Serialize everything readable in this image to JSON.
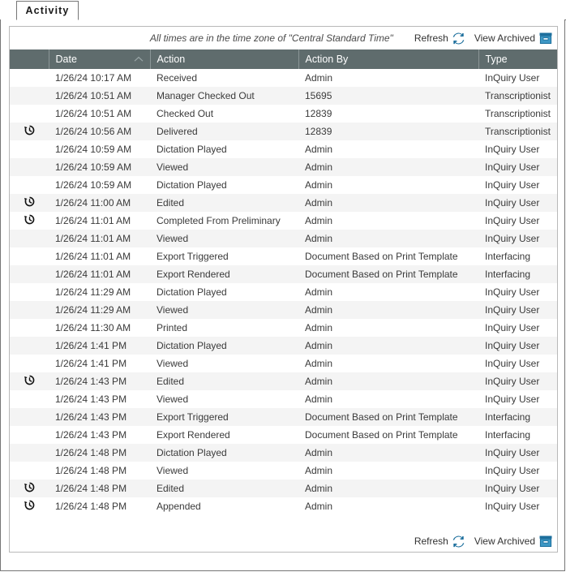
{
  "tab": {
    "label": "Activity"
  },
  "toolbar": {
    "timezone_note": "All times are in the time zone of \"Central Standard Time\"",
    "refresh_label": "Refresh",
    "refresh_icon": "refresh-icon",
    "view_archived_label": "View Archived",
    "view_archived_icon": "archive-box-icon"
  },
  "footer": {
    "refresh_label": "Refresh",
    "refresh_icon": "refresh-icon",
    "view_archived_label": "View Archived",
    "view_archived_icon": "archive-box-icon"
  },
  "colors": {
    "header_bg": "#5f6c6d",
    "accent_icon": "#1b6e9c",
    "row_alt_bg": "#f4f4f4",
    "frame_border": "#767676",
    "card_border": "#b9b9b9"
  },
  "table": {
    "columns": [
      {
        "key": "history",
        "label": ""
      },
      {
        "key": "date",
        "label": "Date",
        "sorted": "asc",
        "sort_icon": "sort-ascending-caret-icon"
      },
      {
        "key": "action",
        "label": "Action"
      },
      {
        "key": "action_by",
        "label": "Action By"
      },
      {
        "key": "type",
        "label": "Type"
      }
    ],
    "rows": [
      {
        "history": false,
        "date": "1/26/24 10:17 AM",
        "action": "Received",
        "action_by": "Admin",
        "type": "InQuiry User"
      },
      {
        "history": false,
        "date": "1/26/24 10:51 AM",
        "action": "Manager Checked Out",
        "action_by": "15695",
        "type": "Transcriptionist"
      },
      {
        "history": false,
        "date": "1/26/24 10:51 AM",
        "action": "Checked Out",
        "action_by": "12839",
        "type": "Transcriptionist"
      },
      {
        "history": true,
        "date": "1/26/24 10:56 AM",
        "action": "Delivered",
        "action_by": "12839",
        "type": "Transcriptionist"
      },
      {
        "history": false,
        "date": "1/26/24 10:59 AM",
        "action": "Dictation Played",
        "action_by": "Admin",
        "type": "InQuiry User"
      },
      {
        "history": false,
        "date": "1/26/24 10:59 AM",
        "action": "Viewed",
        "action_by": "Admin",
        "type": "InQuiry User"
      },
      {
        "history": false,
        "date": "1/26/24 10:59 AM",
        "action": "Dictation Played",
        "action_by": "Admin",
        "type": "InQuiry User"
      },
      {
        "history": true,
        "date": "1/26/24 11:00 AM",
        "action": "Edited",
        "action_by": "Admin",
        "type": "InQuiry User"
      },
      {
        "history": true,
        "date": "1/26/24 11:01 AM",
        "action": "Completed From Preliminary",
        "action_by": "Admin",
        "type": "InQuiry User"
      },
      {
        "history": false,
        "date": "1/26/24 11:01 AM",
        "action": "Viewed",
        "action_by": "Admin",
        "type": "InQuiry User"
      },
      {
        "history": false,
        "date": "1/26/24 11:01 AM",
        "action": "Export Triggered",
        "action_by": "Document Based on Print Template",
        "type": "Interfacing"
      },
      {
        "history": false,
        "date": "1/26/24 11:01 AM",
        "action": "Export Rendered",
        "action_by": "Document Based on Print Template",
        "type": "Interfacing"
      },
      {
        "history": false,
        "date": "1/26/24 11:29 AM",
        "action": "Dictation Played",
        "action_by": "Admin",
        "type": "InQuiry User"
      },
      {
        "history": false,
        "date": "1/26/24 11:29 AM",
        "action": "Viewed",
        "action_by": "Admin",
        "type": "InQuiry User"
      },
      {
        "history": false,
        "date": "1/26/24 11:30 AM",
        "action": "Printed",
        "action_by": "Admin",
        "type": "InQuiry User"
      },
      {
        "history": false,
        "date": "1/26/24 1:41 PM",
        "action": "Dictation Played",
        "action_by": "Admin",
        "type": "InQuiry User"
      },
      {
        "history": false,
        "date": "1/26/24 1:41 PM",
        "action": "Viewed",
        "action_by": "Admin",
        "type": "InQuiry User"
      },
      {
        "history": true,
        "date": "1/26/24 1:43 PM",
        "action": "Edited",
        "action_by": "Admin",
        "type": "InQuiry User"
      },
      {
        "history": false,
        "date": "1/26/24 1:43 PM",
        "action": "Viewed",
        "action_by": "Admin",
        "type": "InQuiry User"
      },
      {
        "history": false,
        "date": "1/26/24 1:43 PM",
        "action": "Export Triggered",
        "action_by": "Document Based on Print Template",
        "type": "Interfacing"
      },
      {
        "history": false,
        "date": "1/26/24 1:43 PM",
        "action": "Export Rendered",
        "action_by": "Document Based on Print Template",
        "type": "Interfacing"
      },
      {
        "history": false,
        "date": "1/26/24 1:48 PM",
        "action": "Dictation Played",
        "action_by": "Admin",
        "type": "InQuiry User"
      },
      {
        "history": false,
        "date": "1/26/24 1:48 PM",
        "action": "Viewed",
        "action_by": "Admin",
        "type": "InQuiry User"
      },
      {
        "history": true,
        "date": "1/26/24 1:48 PM",
        "action": "Edited",
        "action_by": "Admin",
        "type": "InQuiry User"
      },
      {
        "history": true,
        "date": "1/26/24 1:48 PM",
        "action": "Appended",
        "action_by": "Admin",
        "type": "InQuiry User"
      }
    ]
  }
}
